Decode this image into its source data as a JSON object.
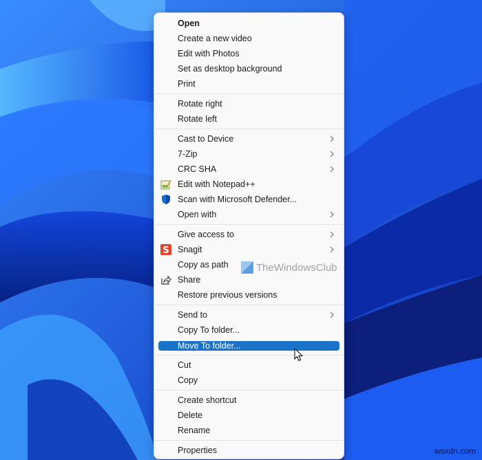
{
  "desktop": {
    "colors": {
      "wallpaper_base": "#0a3fd6",
      "wallpaper_light": "#4fb3ff",
      "wallpaper_dark": "#021a7a"
    }
  },
  "context_menu": {
    "highlight_color": "#1a73c9",
    "groups": [
      [
        {
          "label": "Open",
          "bold": true
        },
        {
          "label": "Create a new video"
        },
        {
          "label": "Edit with Photos"
        },
        {
          "label": "Set as desktop background"
        },
        {
          "label": "Print"
        }
      ],
      [
        {
          "label": "Rotate right"
        },
        {
          "label": "Rotate left"
        }
      ],
      [
        {
          "label": "Cast to Device",
          "submenu": true
        },
        {
          "label": "7-Zip",
          "submenu": true
        },
        {
          "label": "CRC SHA",
          "submenu": true
        },
        {
          "label": "Edit with Notepad++",
          "icon": "notepad-plus-plus-icon"
        },
        {
          "label": "Scan with Microsoft Defender...",
          "icon": "defender-shield-icon"
        },
        {
          "label": "Open with",
          "submenu": true
        }
      ],
      [
        {
          "label": "Give access to",
          "submenu": true
        },
        {
          "label": "Snagit",
          "submenu": true,
          "icon": "snagit-icon"
        },
        {
          "label": "Copy as path"
        },
        {
          "label": "Share",
          "icon": "share-icon"
        },
        {
          "label": "Restore previous versions"
        }
      ],
      [
        {
          "label": "Send to",
          "submenu": true
        },
        {
          "label": "Copy To folder..."
        },
        {
          "label": "Move To folder...",
          "selected": true
        }
      ],
      [
        {
          "label": "Cut"
        },
        {
          "label": "Copy"
        }
      ],
      [
        {
          "label": "Create shortcut"
        },
        {
          "label": "Delete"
        },
        {
          "label": "Rename"
        }
      ],
      [
        {
          "label": "Properties"
        }
      ]
    ]
  },
  "watermarks": {
    "brand": "TheWindowsClub",
    "site": "wsxdn.com"
  }
}
